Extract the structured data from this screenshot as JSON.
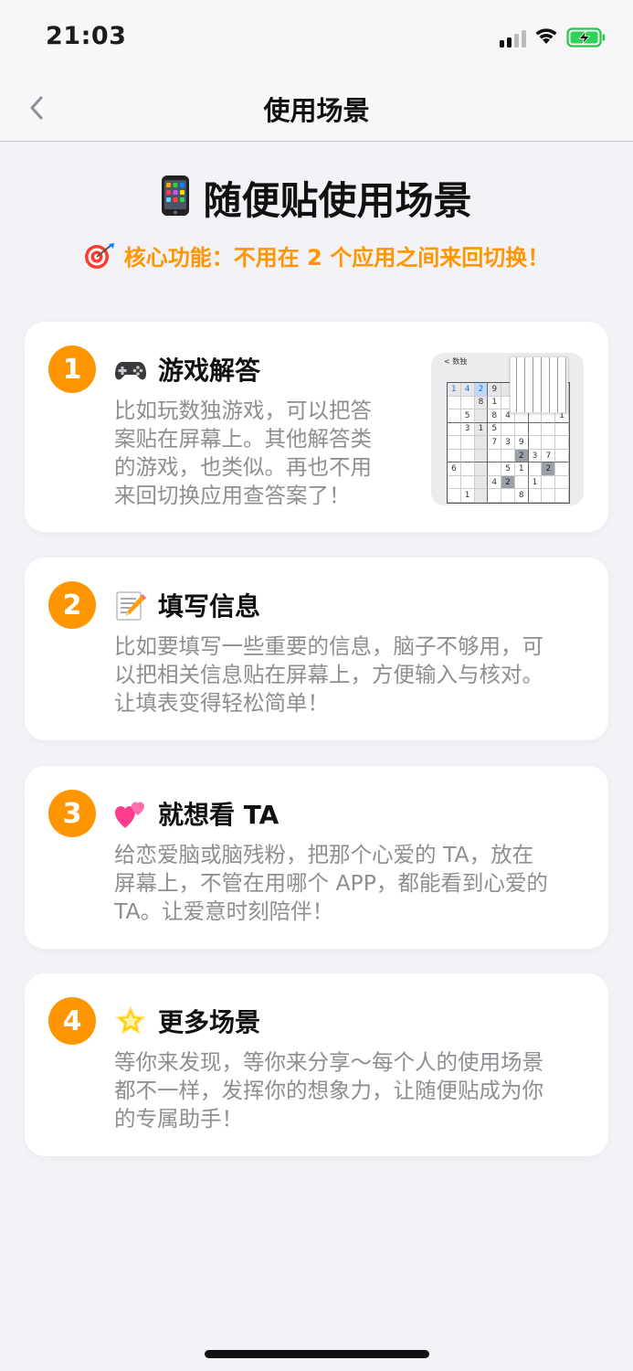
{
  "status": {
    "time": "21:03",
    "icons": [
      "signal-icon",
      "wifi-icon",
      "battery-charging-icon"
    ]
  },
  "nav": {
    "title": "使用场景",
    "back_icon": "chevron-left-icon"
  },
  "hero": {
    "emoji": "mobile-phone-icon",
    "title": "随便贴使用场景",
    "subtitle_emoji": "dart-target-icon",
    "subtitle": "核心功能：不用在 2 个应用之间来回切换！"
  },
  "colors": {
    "accent": "#ff9500",
    "background": "#f2f2f7",
    "card": "#ffffff",
    "desc_text": "#8e8e93"
  },
  "cards": [
    {
      "number": "1",
      "emoji": "game-controller-icon",
      "title": "游戏解答",
      "desc": [
        "比如玩数独游戏，可以把答",
        "案贴在屏幕上。其他解答类",
        "的游戏，也类似。再也不用",
        "来回切换应用查答案了！"
      ],
      "thumbnail": {
        "header": "< 数独",
        "grid": [
          [
            "1",
            "4",
            "2",
            "9",
            "",
            "",
            "",
            "",
            ""
          ],
          [
            "",
            "",
            "8",
            "1",
            "",
            "",
            "",
            "",
            ""
          ],
          [
            "",
            "5",
            "",
            "8",
            "4",
            "",
            "",
            "",
            "1"
          ],
          [
            "",
            "3",
            "1",
            "5",
            "",
            "",
            "",
            "",
            ""
          ],
          [
            "",
            "",
            "",
            "7",
            "3",
            "9",
            "",
            "",
            ""
          ],
          [
            "",
            "",
            "",
            "",
            "",
            "2",
            "3",
            "7",
            ""
          ],
          [
            "6",
            "",
            "",
            "",
            "5",
            "1",
            "",
            "2",
            ""
          ],
          [
            "",
            "",
            "",
            "4",
            "2",
            "",
            "1",
            "",
            ""
          ],
          [
            "",
            "1",
            "",
            "",
            "",
            "8",
            "",
            "",
            ""
          ]
        ]
      }
    },
    {
      "number": "2",
      "emoji": "memo-icon",
      "title": "填写信息",
      "desc": [
        "比如要填写一些重要的信息，脑子不够用，可",
        "以把相关信息贴在屏幕上，方便输入与核对。",
        "让填表变得轻松简单！"
      ]
    },
    {
      "number": "3",
      "emoji": "two-hearts-icon",
      "title": "就想看 TA",
      "desc": [
        "给恋爱脑或脑残粉，把那个心爱的 TA，放在",
        "屏幕上，不管在用哪个 APP，都能看到心爱的",
        "TA。让爱意时刻陪伴！"
      ]
    },
    {
      "number": "4",
      "emoji": "glowing-star-icon",
      "title": "更多场景",
      "desc": [
        "等你来发现，等你来分享～每个人的使用场景",
        "都不一样，发挥你的想象力，让随便贴成为你",
        "的专属助手！"
      ]
    }
  ]
}
